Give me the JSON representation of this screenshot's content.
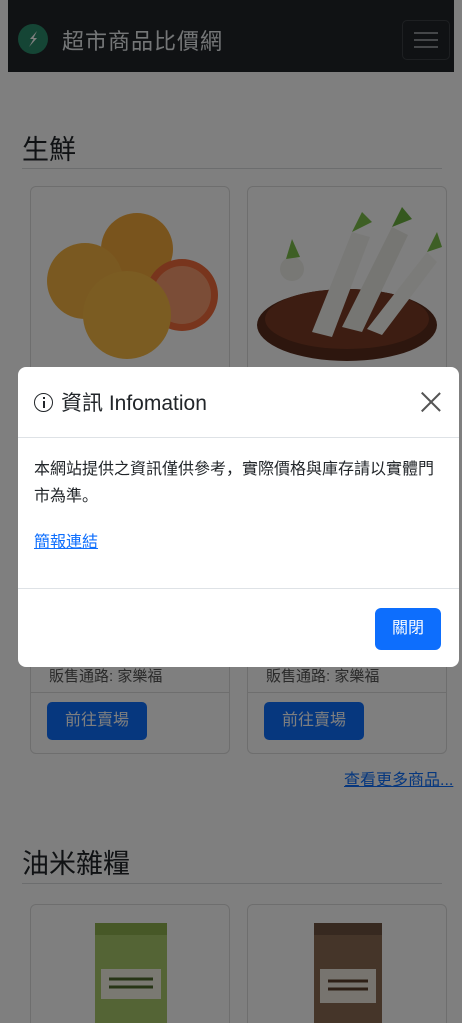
{
  "navbar": {
    "brand": "超市商品比價網",
    "logo_icon": "leaf-logo-icon",
    "menu_icon": "hamburger-menu-icon"
  },
  "sections": [
    {
      "title": "生鮮",
      "cards": [
        {
          "image": "grapefruit",
          "store_text": "販售通路: 家樂福",
          "button": "前往賣場"
        },
        {
          "image": "white-radish",
          "store_text": "販售通路: 家樂福",
          "button": "前往賣場"
        }
      ],
      "more_link": "查看更多商品..."
    },
    {
      "title": "油米雜糧",
      "cards": [
        {
          "image": "rice-bag-green"
        },
        {
          "image": "rice-bag-brown"
        }
      ]
    }
  ],
  "modal": {
    "title": "資訊 Infomation",
    "body": "本網站提供之資訊僅供參考，實際價格與庫存請以實體門市為準。",
    "link": "簡報連結",
    "close_button": "關閉"
  }
}
